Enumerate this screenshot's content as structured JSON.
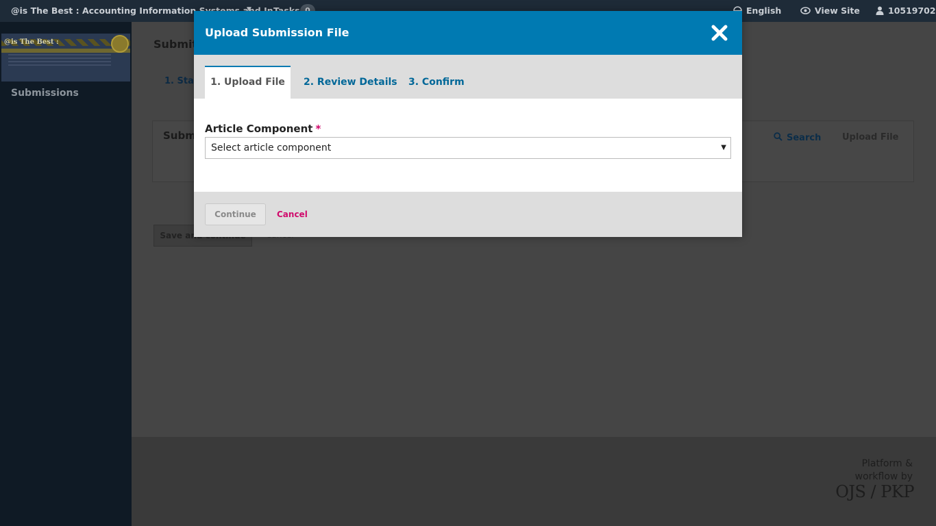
{
  "topbar": {
    "site_title": "@is The Best : Accounting Information Systems and In...",
    "tasks_label": "Tasks",
    "tasks_count": "0",
    "language": "English",
    "view_site": "View Site",
    "user": "10519702"
  },
  "sidebar": {
    "logo_title": "@is The Best :",
    "items": [
      {
        "label": "Submissions"
      }
    ]
  },
  "main": {
    "heading": "Submit",
    "step_tab": "1. Star",
    "panel_title": "Subm",
    "search_label": "Search",
    "upload_label": "Upload File",
    "save_label": "Save and continue",
    "cancel_label": "Cancel"
  },
  "footer": {
    "platform_line1": "Platform &",
    "platform_line2": "workflow by",
    "brand": "OJS / PKP"
  },
  "modal": {
    "title": "Upload Submission File",
    "tabs": [
      {
        "label": "1. Upload File",
        "active": true
      },
      {
        "label": "2. Review Details",
        "active": false
      },
      {
        "label": "3. Confirm",
        "active": false
      }
    ],
    "field_label": "Article Component",
    "required_mark": "*",
    "select_value": "Select article component",
    "continue_label": "Continue",
    "cancel_label": "Cancel"
  },
  "colors": {
    "modal_header": "#007ab2",
    "link": "#006798",
    "cancel": "#d00a6c"
  }
}
